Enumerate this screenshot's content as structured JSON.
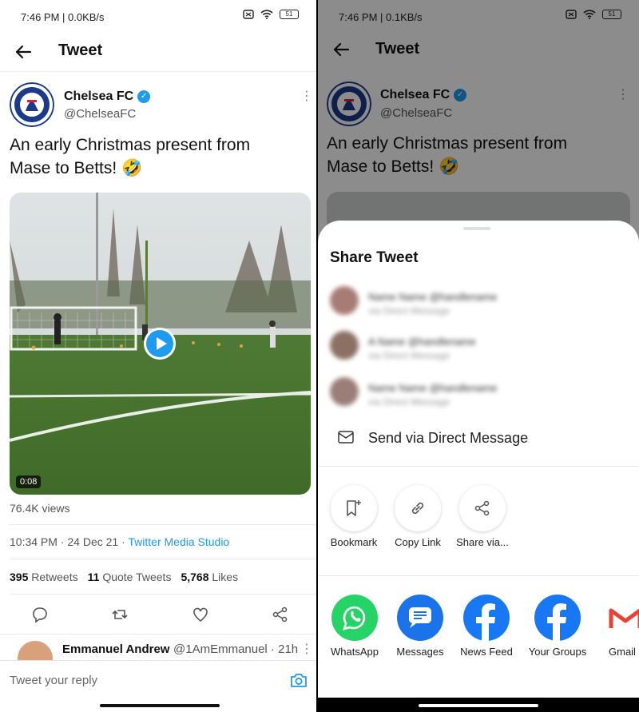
{
  "left": {
    "status": {
      "time": "7:46 PM | 0.0KB/s",
      "battery": "51"
    },
    "header": {
      "title": "Tweet"
    },
    "tweet": {
      "author_name": "Chelsea FC",
      "author_handle": "@ChelseaFC",
      "text_line1": "An early Christmas present from",
      "text_line2": "Mase to Betts! 🤣",
      "video_duration": "0:08",
      "views": "76.4K views",
      "time_date": "10:34 PM · 24 Dec 21 · ",
      "source": "Twitter Media Studio",
      "retweets_count": "395",
      "retweets_label": "Retweets",
      "quotes_count": "11",
      "quotes_label": "Quote Tweets",
      "likes_count": "5,768",
      "likes_label": "Likes"
    },
    "reply": {
      "name": "Emmanuel Andrew",
      "handle": "@1AmEmmanuel · 21h"
    },
    "composer": {
      "placeholder": "Tweet your reply"
    }
  },
  "right": {
    "status": {
      "time": "7:46 PM | 0.1KB/s",
      "battery": "51"
    },
    "header": {
      "title": "Tweet"
    },
    "tweet": {
      "author_name": "Chelsea FC",
      "author_handle": "@ChelseaFC",
      "text_line1": "An early Christmas present from",
      "text_line2": "Mase to Betts! 🤣"
    },
    "sheet": {
      "title": "Share Tweet",
      "contacts": [
        {
          "name": "Name Name @handlename",
          "sub": "via Direct Message"
        },
        {
          "name": "A Name @handlename",
          "sub": "via Direct Message"
        },
        {
          "name": "Name Name @handlename",
          "sub": "via Direct Message"
        }
      ],
      "dm_label": "Send via Direct Message",
      "actions": [
        "Bookmark",
        "Copy Link",
        "Share via..."
      ],
      "apps": [
        "WhatsApp",
        "Messages",
        "News Feed",
        "Your Groups",
        "Gmail"
      ]
    }
  },
  "colors": {
    "twitter_blue": "#1d9bf0",
    "whatsapp": "#25d366",
    "messages": "#1a73e8",
    "facebook": "#1877f2",
    "gmail_red": "#ea4335"
  }
}
